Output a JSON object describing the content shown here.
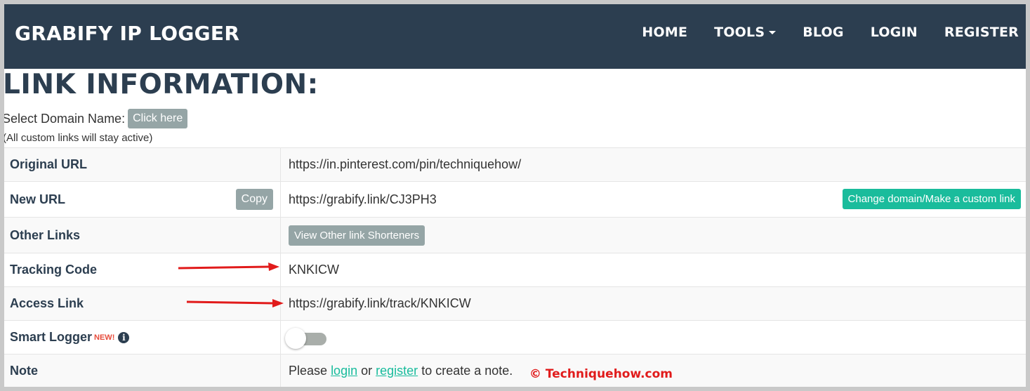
{
  "navbar": {
    "brand": "GRABIFY IP LOGGER",
    "items": [
      "HOME",
      "TOOLS",
      "BLOG",
      "LOGIN",
      "REGISTER"
    ]
  },
  "page": {
    "title": "LINK INFORMATION:",
    "select_domain_label": "Select Domain Name:",
    "click_here": "Click here",
    "custom_links_note": "(All custom links will stay active)"
  },
  "rows": {
    "original_url": {
      "label": "Original URL",
      "value": "https://in.pinterest.com/pin/techniquehow/"
    },
    "new_url": {
      "label": "New URL",
      "copy": "Copy",
      "value": "https://grabify.link/CJ3PH3",
      "change_domain": "Change domain/Make a custom link"
    },
    "other_links": {
      "label": "Other Links",
      "button": "View Other link Shorteners"
    },
    "tracking_code": {
      "label": "Tracking Code",
      "value": "KNKICW"
    },
    "access_link": {
      "label": "Access Link",
      "value": "https://grabify.link/track/KNKICW"
    },
    "smart_logger": {
      "label": "Smart Logger",
      "badge": "NEW!",
      "info": "i",
      "enabled": false
    },
    "note": {
      "label": "Note",
      "prefix": "Please",
      "login": "login",
      "or": "or",
      "register": "register",
      "suffix": "to create a note."
    }
  },
  "watermark": "© Techniquehow.com",
  "colors": {
    "navbar": "#2c3e50",
    "primary_text": "#2c3e50",
    "grey_button": "#95a5a6",
    "green_button": "#1abc9c",
    "arrow": "#e11b1b"
  }
}
